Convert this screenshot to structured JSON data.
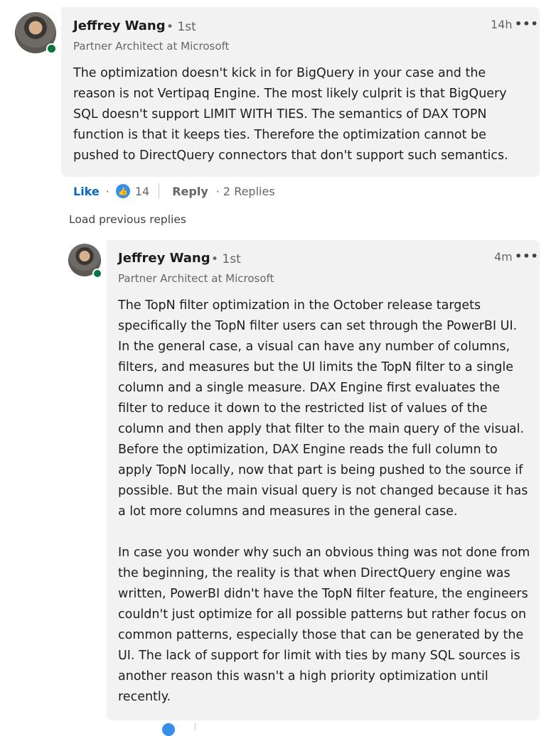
{
  "comment": {
    "author": "Jeffrey Wang",
    "degree": "• 1st",
    "headline": "Partner Architect at Microsoft",
    "time": "14h",
    "more": "•••",
    "text": "The optimization doesn't kick in for BigQuery in your case and the reason is not Vertipaq Engine. The most likely culprit is that BigQuery SQL doesn't support LIMIT WITH TIES. The semantics of DAX TOPN function is that it keeps ties. Therefore the optimization cannot be pushed to DirectQuery connectors that don't support such semantics.",
    "actions": {
      "like": "Like",
      "dot": "·",
      "reaction_count": "14",
      "reply": "Reply",
      "replies": "· 2 Replies"
    }
  },
  "load_previous": "Load previous replies",
  "reply": {
    "author": "Jeffrey Wang",
    "degree": "• 1st",
    "headline": "Partner Architect at Microsoft",
    "time": "4m",
    "more": "•••",
    "text_p1": "The TopN filter optimization in the October release targets specifically the TopN filter users can set through the PowerBI UI. In the general case, a visual can have any number of columns, filters, and measures but the UI limits the TopN filter to a single column and a single measure. DAX Engine first evaluates the filter to reduce it down to the restricted list of values of the column and then apply that filter to the main query of the visual. Before the optimization, DAX Engine reads the full column to apply TopN locally, now that part is being pushed to the source if possible. But the main visual query is not changed because it has a lot more columns and measures in the general case.",
    "text_p2": "In case you wonder why such an obvious thing was not done from the beginning, the reality is that when DirectQuery engine was written, PowerBI didn't have the TopN filter feature, the engineers couldn't just optimize for all possible patterns but rather focus on common patterns, especially those that can be generated by the UI. The lack of support for limit with ties by many SQL sources is another reason this wasn't a high priority optimization until recently."
  },
  "colors": {
    "bubble": "#f2f2f2",
    "link": "#0a66c2",
    "presence": "#057642",
    "reaction": "#378fe9"
  }
}
